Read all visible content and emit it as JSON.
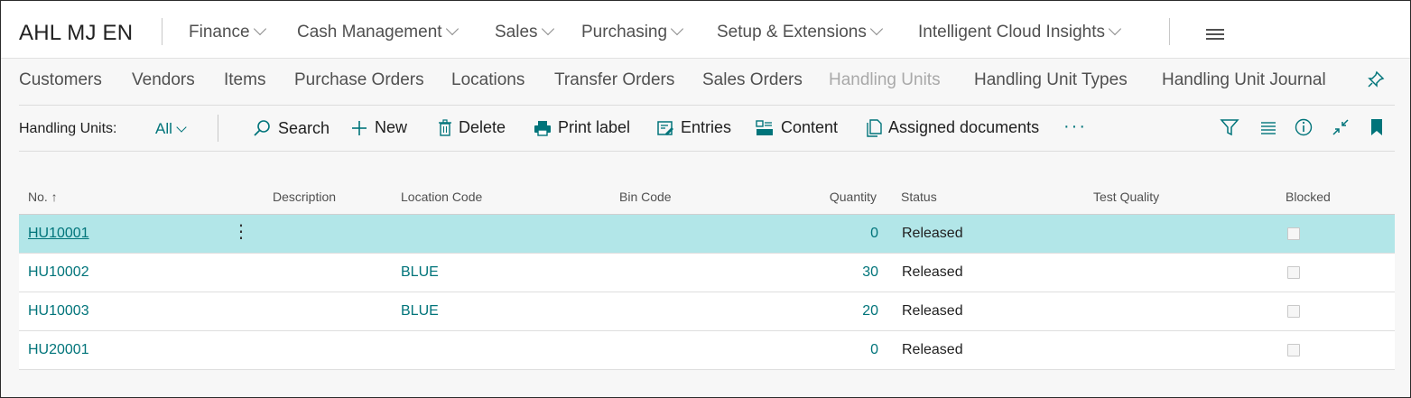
{
  "app": {
    "company": "AHL MJ EN",
    "top_menu": [
      "Finance",
      "Cash Management",
      "Sales",
      "Purchasing",
      "Setup & Extensions",
      "Intelligent Cloud Insights"
    ]
  },
  "nav": {
    "items": [
      "Customers",
      "Vendors",
      "Items",
      "Purchase Orders",
      "Locations",
      "Transfer Orders",
      "Sales Orders",
      "Handling Units",
      "Handling Unit Types",
      "Handling Unit Journal"
    ],
    "active": "Handling Units"
  },
  "page": {
    "caption": "Handling Units:",
    "view": "All"
  },
  "actions": {
    "search": "Search",
    "new": "New",
    "delete": "Delete",
    "print_label": "Print label",
    "entries": "Entries",
    "content": "Content",
    "assigned_documents": "Assigned documents",
    "more": "···"
  },
  "table": {
    "columns": {
      "no": "No. ↑",
      "description": "Description",
      "location_code": "Location Code",
      "bin_code": "Bin Code",
      "quantity": "Quantity",
      "status": "Status",
      "test_quality": "Test Quality",
      "blocked": "Blocked"
    },
    "rows": [
      {
        "no": "HU10001",
        "description": "",
        "location_code": "",
        "bin_code": "",
        "quantity": "0",
        "status": "Released",
        "test_quality": "",
        "blocked": false
      },
      {
        "no": "HU10002",
        "description": "",
        "location_code": "BLUE",
        "bin_code": "",
        "quantity": "30",
        "status": "Released",
        "test_quality": "",
        "blocked": false
      },
      {
        "no": "HU10003",
        "description": "",
        "location_code": "BLUE",
        "bin_code": "",
        "quantity": "20",
        "status": "Released",
        "test_quality": "",
        "blocked": false
      },
      {
        "no": "HU20001",
        "description": "",
        "location_code": "",
        "bin_code": "",
        "quantity": "0",
        "status": "Released",
        "test_quality": "",
        "blocked": false
      }
    ]
  },
  "colors": {
    "accent": "#00747a",
    "selected_row": "#b2e6e8",
    "muted_nav": "#a9a9a9"
  }
}
